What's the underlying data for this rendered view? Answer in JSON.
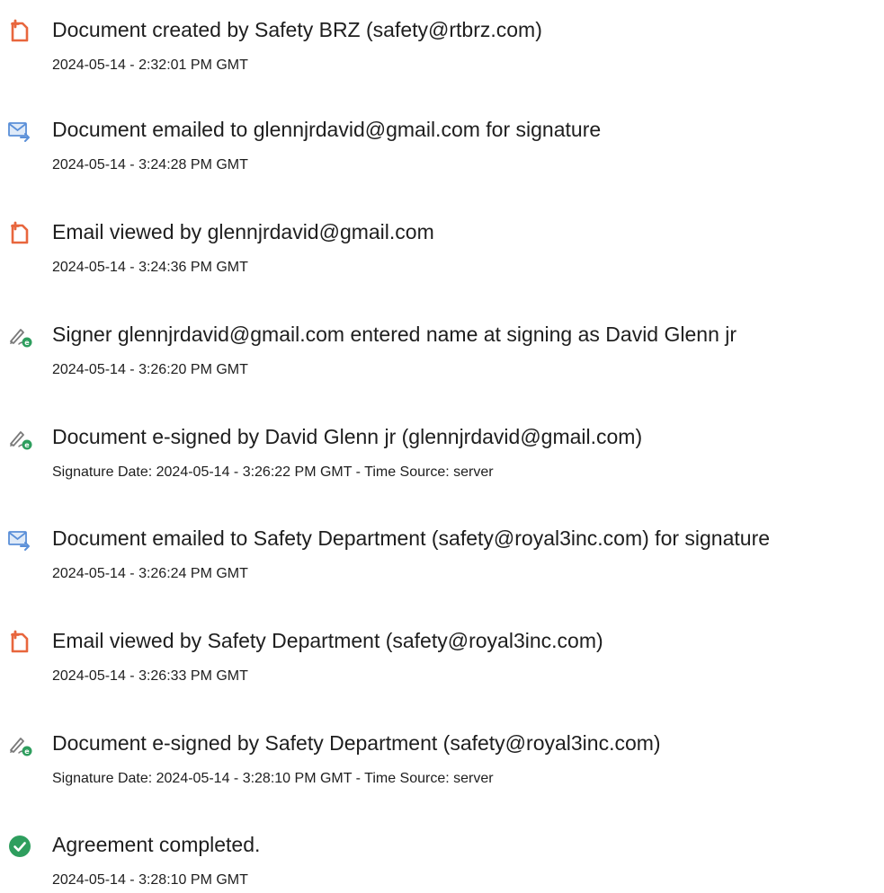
{
  "colors": {
    "doc_icon": "#e8663d",
    "email_icon": "#5a8fd8",
    "sign_icon": "#2e9e5e",
    "complete_icon": "#2e9e5e",
    "text": "#1e1e1e"
  },
  "events": [
    {
      "icon": "document-icon",
      "title": "Document created by Safety BRZ (safety@rtbrz.com)",
      "detail": "2024-05-14 - 2:32:01 PM GMT"
    },
    {
      "icon": "email-sent-icon",
      "title": "Document emailed to glennjrdavid@gmail.com for signature",
      "detail": "2024-05-14 - 3:24:28 PM GMT"
    },
    {
      "icon": "document-icon",
      "title": "Email viewed by glennjrdavid@gmail.com",
      "detail": "2024-05-14 - 3:24:36 PM GMT"
    },
    {
      "icon": "esign-pen-icon",
      "title": "Signer glennjrdavid@gmail.com entered name at signing as David Glenn jr",
      "detail": "2024-05-14 - 3:26:20 PM GMT"
    },
    {
      "icon": "esign-pen-icon",
      "title": "Document e-signed by David Glenn jr (glennjrdavid@gmail.com)",
      "detail": "Signature Date: 2024-05-14 - 3:26:22 PM GMT - Time Source: server"
    },
    {
      "icon": "email-sent-icon",
      "title": "Document emailed to Safety Department (safety@royal3inc.com) for signature",
      "detail": "2024-05-14 - 3:26:24 PM GMT"
    },
    {
      "icon": "document-icon",
      "title": "Email viewed by Safety Department (safety@royal3inc.com)",
      "detail": "2024-05-14 - 3:26:33 PM GMT"
    },
    {
      "icon": "esign-pen-icon",
      "title": "Document e-signed by Safety Department (safety@royal3inc.com)",
      "detail": "Signature Date: 2024-05-14 - 3:28:10 PM GMT - Time Source: server"
    },
    {
      "icon": "check-circle-icon",
      "title": "Agreement completed.",
      "detail": "2024-05-14 - 3:28:10 PM GMT"
    }
  ]
}
